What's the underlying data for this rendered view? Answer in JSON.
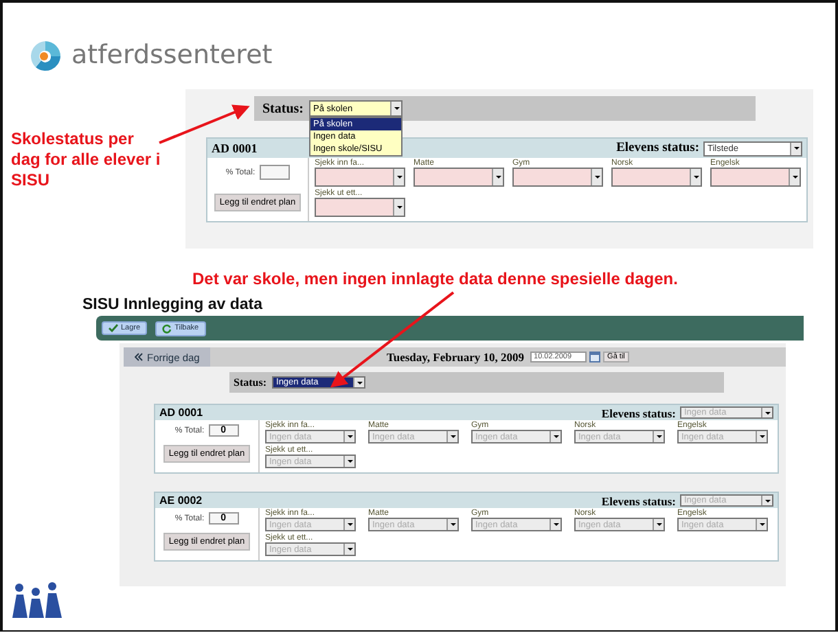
{
  "logo": {
    "text": "atferdssenteret"
  },
  "annotations": [
    {
      "text": "Skolestatus per dag for alle elever i SISU"
    },
    {
      "text": "Det var skole, men ingen innlagte data denne spesielle dagen."
    }
  ],
  "screenshot_1": {
    "status_label": "Status:",
    "status_value": "På skolen",
    "status_options": [
      {
        "label": "På skolen",
        "selected": true
      },
      {
        "label": "Ingen data",
        "selected": false
      },
      {
        "label": "Ingen skole/SISU",
        "selected": false
      }
    ],
    "students": [
      {
        "id": "AD 0001",
        "status_label": "Elevens status:",
        "status_value": "Tilstede",
        "total_label": "% Total:",
        "plan_button": "Legg til endret plan",
        "disabled": false,
        "fields": [
          {
            "label": "Sjekk inn fa..."
          },
          {
            "label": "Matte"
          },
          {
            "label": "Gym"
          },
          {
            "label": "Norsk"
          },
          {
            "label": "Engelsk"
          },
          {
            "label": "Sjekk ut ett..."
          }
        ]
      }
    ]
  },
  "screenshot_2": {
    "title": "SISU Innlegging av data",
    "toolbar_buttons": [
      {
        "label": "Lagre",
        "kind": "save"
      },
      {
        "label": "Tilbake",
        "kind": "back"
      }
    ],
    "prev_day": "Forrige dag",
    "date": "Tuesday, February 10, 2009",
    "date_field": "10.02.2009",
    "go_button": "Gå til",
    "status_label": "Status:",
    "status_value": "Ingen data",
    "students": [
      {
        "id": "AD 0001",
        "status_label": "Elevens status:",
        "status_value": "Ingen data",
        "total_label": "% Total:",
        "total_value": "0",
        "plan_button": "Legg til endret plan",
        "disabled": true,
        "fields": [
          {
            "label": "Sjekk inn fa...",
            "value": "Ingen data"
          },
          {
            "label": "Matte",
            "value": "Ingen data"
          },
          {
            "label": "Gym",
            "value": "Ingen data"
          },
          {
            "label": "Norsk",
            "value": "Ingen data"
          },
          {
            "label": "Engelsk",
            "value": "Ingen data"
          },
          {
            "label": "Sjekk ut ett...",
            "value": "Ingen data"
          }
        ]
      },
      {
        "id": "AE 0002",
        "status_label": "Elevens status:",
        "status_value": "Ingen data",
        "total_label": "% Total:",
        "total_value": "0",
        "plan_button": "Legg til endret plan",
        "disabled": true,
        "fields": [
          {
            "label": "Sjekk inn fa...",
            "value": "Ingen data"
          },
          {
            "label": "Matte",
            "value": "Ingen data"
          },
          {
            "label": "Gym",
            "value": "Ingen data"
          },
          {
            "label": "Norsk",
            "value": "Ingen data"
          },
          {
            "label": "Engelsk",
            "value": "Ingen data"
          },
          {
            "label": "Sjekk ut ett...",
            "value": "Ingen data"
          }
        ]
      }
    ]
  }
}
